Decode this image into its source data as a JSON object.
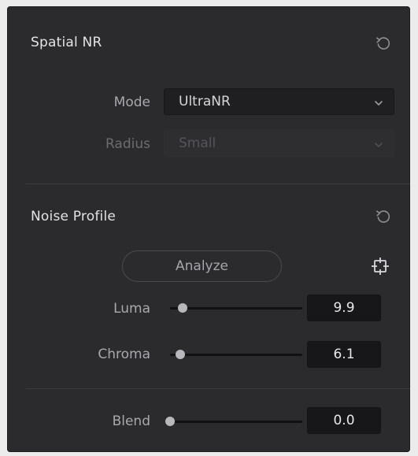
{
  "spatial_nr": {
    "title": "Spatial NR",
    "reset_icon": "reset-icon",
    "mode": {
      "label": "Mode",
      "value": "UltraNR"
    },
    "radius": {
      "label": "Radius",
      "value": "Small",
      "disabled": true
    }
  },
  "noise_profile": {
    "title": "Noise Profile",
    "reset_icon": "reset-icon",
    "analyze_label": "Analyze",
    "target_icon": "crosshair-icon",
    "luma": {
      "label": "Luma",
      "value": "9.9",
      "slider_fraction": 0.05
    },
    "chroma": {
      "label": "Chroma",
      "value": "6.1",
      "slider_fraction": 0.03
    }
  },
  "blend": {
    "label": "Blend",
    "value": "0.0",
    "slider_fraction": 0.0
  },
  "colors": {
    "panel_bg": "#2b2b2d",
    "field_bg": "#1f1f21",
    "text_primary": "#e3e3e5",
    "text_secondary": "#a9a9ad",
    "text_disabled": "#55555a"
  }
}
